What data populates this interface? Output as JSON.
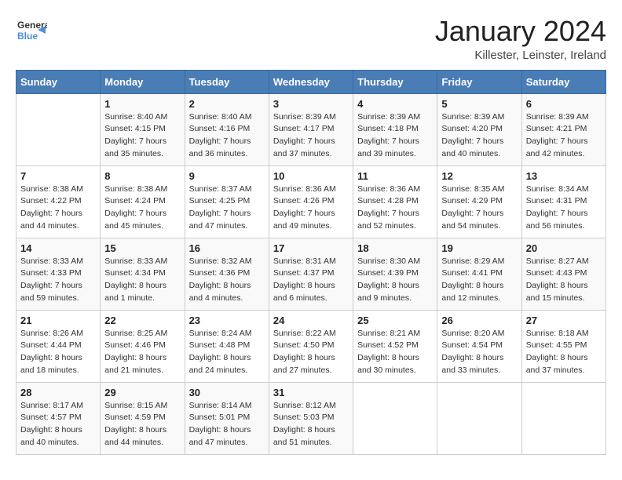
{
  "logo": {
    "general": "General",
    "blue": "Blue"
  },
  "title": "January 2024",
  "subtitle": "Killester, Leinster, Ireland",
  "days_of_week": [
    "Sunday",
    "Monday",
    "Tuesday",
    "Wednesday",
    "Thursday",
    "Friday",
    "Saturday"
  ],
  "weeks": [
    [
      {
        "day": "",
        "sunrise": "",
        "sunset": "",
        "daylight": ""
      },
      {
        "day": "1",
        "sunrise": "Sunrise: 8:40 AM",
        "sunset": "Sunset: 4:15 PM",
        "daylight": "Daylight: 7 hours and 35 minutes."
      },
      {
        "day": "2",
        "sunrise": "Sunrise: 8:40 AM",
        "sunset": "Sunset: 4:16 PM",
        "daylight": "Daylight: 7 hours and 36 minutes."
      },
      {
        "day": "3",
        "sunrise": "Sunrise: 8:39 AM",
        "sunset": "Sunset: 4:17 PM",
        "daylight": "Daylight: 7 hours and 37 minutes."
      },
      {
        "day": "4",
        "sunrise": "Sunrise: 8:39 AM",
        "sunset": "Sunset: 4:18 PM",
        "daylight": "Daylight: 7 hours and 39 minutes."
      },
      {
        "day": "5",
        "sunrise": "Sunrise: 8:39 AM",
        "sunset": "Sunset: 4:20 PM",
        "daylight": "Daylight: 7 hours and 40 minutes."
      },
      {
        "day": "6",
        "sunrise": "Sunrise: 8:39 AM",
        "sunset": "Sunset: 4:21 PM",
        "daylight": "Daylight: 7 hours and 42 minutes."
      }
    ],
    [
      {
        "day": "7",
        "sunrise": "Sunrise: 8:38 AM",
        "sunset": "Sunset: 4:22 PM",
        "daylight": "Daylight: 7 hours and 44 minutes."
      },
      {
        "day": "8",
        "sunrise": "Sunrise: 8:38 AM",
        "sunset": "Sunset: 4:24 PM",
        "daylight": "Daylight: 7 hours and 45 minutes."
      },
      {
        "day": "9",
        "sunrise": "Sunrise: 8:37 AM",
        "sunset": "Sunset: 4:25 PM",
        "daylight": "Daylight: 7 hours and 47 minutes."
      },
      {
        "day": "10",
        "sunrise": "Sunrise: 8:36 AM",
        "sunset": "Sunset: 4:26 PM",
        "daylight": "Daylight: 7 hours and 49 minutes."
      },
      {
        "day": "11",
        "sunrise": "Sunrise: 8:36 AM",
        "sunset": "Sunset: 4:28 PM",
        "daylight": "Daylight: 7 hours and 52 minutes."
      },
      {
        "day": "12",
        "sunrise": "Sunrise: 8:35 AM",
        "sunset": "Sunset: 4:29 PM",
        "daylight": "Daylight: 7 hours and 54 minutes."
      },
      {
        "day": "13",
        "sunrise": "Sunrise: 8:34 AM",
        "sunset": "Sunset: 4:31 PM",
        "daylight": "Daylight: 7 hours and 56 minutes."
      }
    ],
    [
      {
        "day": "14",
        "sunrise": "Sunrise: 8:33 AM",
        "sunset": "Sunset: 4:33 PM",
        "daylight": "Daylight: 7 hours and 59 minutes."
      },
      {
        "day": "15",
        "sunrise": "Sunrise: 8:33 AM",
        "sunset": "Sunset: 4:34 PM",
        "daylight": "Daylight: 8 hours and 1 minute."
      },
      {
        "day": "16",
        "sunrise": "Sunrise: 8:32 AM",
        "sunset": "Sunset: 4:36 PM",
        "daylight": "Daylight: 8 hours and 4 minutes."
      },
      {
        "day": "17",
        "sunrise": "Sunrise: 8:31 AM",
        "sunset": "Sunset: 4:37 PM",
        "daylight": "Daylight: 8 hours and 6 minutes."
      },
      {
        "day": "18",
        "sunrise": "Sunrise: 8:30 AM",
        "sunset": "Sunset: 4:39 PM",
        "daylight": "Daylight: 8 hours and 9 minutes."
      },
      {
        "day": "19",
        "sunrise": "Sunrise: 8:29 AM",
        "sunset": "Sunset: 4:41 PM",
        "daylight": "Daylight: 8 hours and 12 minutes."
      },
      {
        "day": "20",
        "sunrise": "Sunrise: 8:27 AM",
        "sunset": "Sunset: 4:43 PM",
        "daylight": "Daylight: 8 hours and 15 minutes."
      }
    ],
    [
      {
        "day": "21",
        "sunrise": "Sunrise: 8:26 AM",
        "sunset": "Sunset: 4:44 PM",
        "daylight": "Daylight: 8 hours and 18 minutes."
      },
      {
        "day": "22",
        "sunrise": "Sunrise: 8:25 AM",
        "sunset": "Sunset: 4:46 PM",
        "daylight": "Daylight: 8 hours and 21 minutes."
      },
      {
        "day": "23",
        "sunrise": "Sunrise: 8:24 AM",
        "sunset": "Sunset: 4:48 PM",
        "daylight": "Daylight: 8 hours and 24 minutes."
      },
      {
        "day": "24",
        "sunrise": "Sunrise: 8:22 AM",
        "sunset": "Sunset: 4:50 PM",
        "daylight": "Daylight: 8 hours and 27 minutes."
      },
      {
        "day": "25",
        "sunrise": "Sunrise: 8:21 AM",
        "sunset": "Sunset: 4:52 PM",
        "daylight": "Daylight: 8 hours and 30 minutes."
      },
      {
        "day": "26",
        "sunrise": "Sunrise: 8:20 AM",
        "sunset": "Sunset: 4:54 PM",
        "daylight": "Daylight: 8 hours and 33 minutes."
      },
      {
        "day": "27",
        "sunrise": "Sunrise: 8:18 AM",
        "sunset": "Sunset: 4:55 PM",
        "daylight": "Daylight: 8 hours and 37 minutes."
      }
    ],
    [
      {
        "day": "28",
        "sunrise": "Sunrise: 8:17 AM",
        "sunset": "Sunset: 4:57 PM",
        "daylight": "Daylight: 8 hours and 40 minutes."
      },
      {
        "day": "29",
        "sunrise": "Sunrise: 8:15 AM",
        "sunset": "Sunset: 4:59 PM",
        "daylight": "Daylight: 8 hours and 44 minutes."
      },
      {
        "day": "30",
        "sunrise": "Sunrise: 8:14 AM",
        "sunset": "Sunset: 5:01 PM",
        "daylight": "Daylight: 8 hours and 47 minutes."
      },
      {
        "day": "31",
        "sunrise": "Sunrise: 8:12 AM",
        "sunset": "Sunset: 5:03 PM",
        "daylight": "Daylight: 8 hours and 51 minutes."
      },
      {
        "day": "",
        "sunrise": "",
        "sunset": "",
        "daylight": ""
      },
      {
        "day": "",
        "sunrise": "",
        "sunset": "",
        "daylight": ""
      },
      {
        "day": "",
        "sunrise": "",
        "sunset": "",
        "daylight": ""
      }
    ]
  ]
}
